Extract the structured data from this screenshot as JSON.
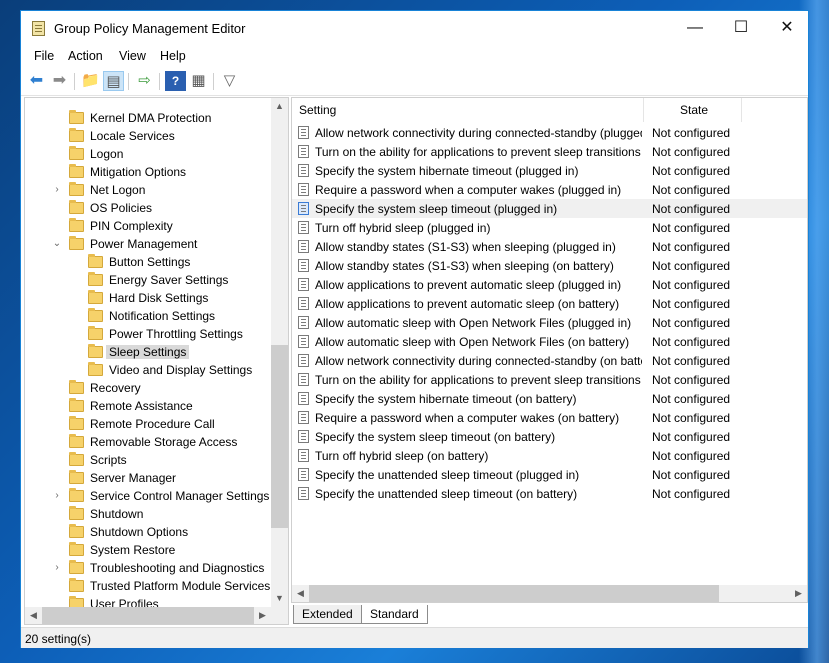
{
  "window": {
    "title": "Group Policy Management Editor",
    "minimize": "—",
    "maximize": "☐",
    "close": "✕"
  },
  "menu": [
    "File",
    "Action",
    "View",
    "Help"
  ],
  "toolbar_icons": [
    "back-icon",
    "forward-icon",
    "up-folder-icon",
    "show-hide-tree-icon",
    "export-list-icon",
    "help-icon",
    "properties-icon",
    "filter-icon"
  ],
  "tree": {
    "items": [
      {
        "label": "Kernel DMA Protection",
        "level": 0,
        "expander": ""
      },
      {
        "label": "Locale Services",
        "level": 0,
        "expander": ""
      },
      {
        "label": "Logon",
        "level": 0,
        "expander": ""
      },
      {
        "label": "Mitigation Options",
        "level": 0,
        "expander": ""
      },
      {
        "label": "Net Logon",
        "level": 0,
        "expander": ">"
      },
      {
        "label": "OS Policies",
        "level": 0,
        "expander": ""
      },
      {
        "label": "PIN Complexity",
        "level": 0,
        "expander": ""
      },
      {
        "label": "Power Management",
        "level": 0,
        "expander": "v"
      },
      {
        "label": "Button Settings",
        "level": 1,
        "expander": ""
      },
      {
        "label": "Energy Saver Settings",
        "level": 1,
        "expander": ""
      },
      {
        "label": "Hard Disk Settings",
        "level": 1,
        "expander": ""
      },
      {
        "label": "Notification Settings",
        "level": 1,
        "expander": ""
      },
      {
        "label": "Power Throttling Settings",
        "level": 1,
        "expander": ""
      },
      {
        "label": "Sleep Settings",
        "level": 1,
        "expander": "",
        "selected": true
      },
      {
        "label": "Video and Display Settings",
        "level": 1,
        "expander": ""
      },
      {
        "label": "Recovery",
        "level": 0,
        "expander": ""
      },
      {
        "label": "Remote Assistance",
        "level": 0,
        "expander": ""
      },
      {
        "label": "Remote Procedure Call",
        "level": 0,
        "expander": ""
      },
      {
        "label": "Removable Storage Access",
        "level": 0,
        "expander": ""
      },
      {
        "label": "Scripts",
        "level": 0,
        "expander": ""
      },
      {
        "label": "Server Manager",
        "level": 0,
        "expander": ""
      },
      {
        "label": "Service Control Manager Settings",
        "level": 0,
        "expander": ">"
      },
      {
        "label": "Shutdown",
        "level": 0,
        "expander": ""
      },
      {
        "label": "Shutdown Options",
        "level": 0,
        "expander": ""
      },
      {
        "label": "System Restore",
        "level": 0,
        "expander": ""
      },
      {
        "label": "Troubleshooting and Diagnostics",
        "level": 0,
        "expander": ">"
      },
      {
        "label": "Trusted Platform Module Services",
        "level": 0,
        "expander": ""
      },
      {
        "label": "User Profiles",
        "level": 0,
        "expander": ""
      }
    ]
  },
  "list": {
    "columns": {
      "setting": "Setting",
      "state": "State"
    },
    "rows": [
      {
        "setting": "Allow network connectivity during connected-standby (plugged in)",
        "state": "Not configured"
      },
      {
        "setting": "Turn on the ability for applications to prevent sleep transitions (plugged in)",
        "state": "Not configured"
      },
      {
        "setting": "Specify the system hibernate timeout (plugged in)",
        "state": "Not configured"
      },
      {
        "setting": "Require a password when a computer wakes (plugged in)",
        "state": "Not configured"
      },
      {
        "setting": "Specify the system sleep timeout (plugged in)",
        "state": "Not configured",
        "highlighted": true
      },
      {
        "setting": "Turn off hybrid sleep (plugged in)",
        "state": "Not configured"
      },
      {
        "setting": "Allow standby states (S1-S3) when sleeping (plugged in)",
        "state": "Not configured"
      },
      {
        "setting": "Allow standby states (S1-S3) when sleeping (on battery)",
        "state": "Not configured"
      },
      {
        "setting": "Allow applications to prevent automatic sleep (plugged in)",
        "state": "Not configured"
      },
      {
        "setting": "Allow applications to prevent automatic sleep (on battery)",
        "state": "Not configured"
      },
      {
        "setting": "Allow automatic sleep with Open Network Files (plugged in)",
        "state": "Not configured"
      },
      {
        "setting": "Allow automatic sleep with Open Network Files (on battery)",
        "state": "Not configured"
      },
      {
        "setting": "Allow network connectivity during connected-standby (on battery)",
        "state": "Not configured"
      },
      {
        "setting": "Turn on the ability for applications to prevent sleep transitions (on battery)",
        "state": "Not configured"
      },
      {
        "setting": "Specify the system hibernate timeout (on battery)",
        "state": "Not configured"
      },
      {
        "setting": "Require a password when a computer wakes (on battery)",
        "state": "Not configured"
      },
      {
        "setting": "Specify the system sleep timeout (on battery)",
        "state": "Not configured"
      },
      {
        "setting": "Turn off hybrid sleep (on battery)",
        "state": "Not configured"
      },
      {
        "setting": "Specify the unattended sleep timeout (plugged in)",
        "state": "Not configured"
      },
      {
        "setting": "Specify the unattended sleep timeout (on battery)",
        "state": "Not configured"
      }
    ]
  },
  "tabs": {
    "extended": "Extended",
    "standard": "Standard"
  },
  "status": {
    "text": "20 setting(s)"
  },
  "colors": {
    "accent": "#1883d7",
    "selection": "#d9d9d9",
    "folder": "#f6d26a"
  }
}
